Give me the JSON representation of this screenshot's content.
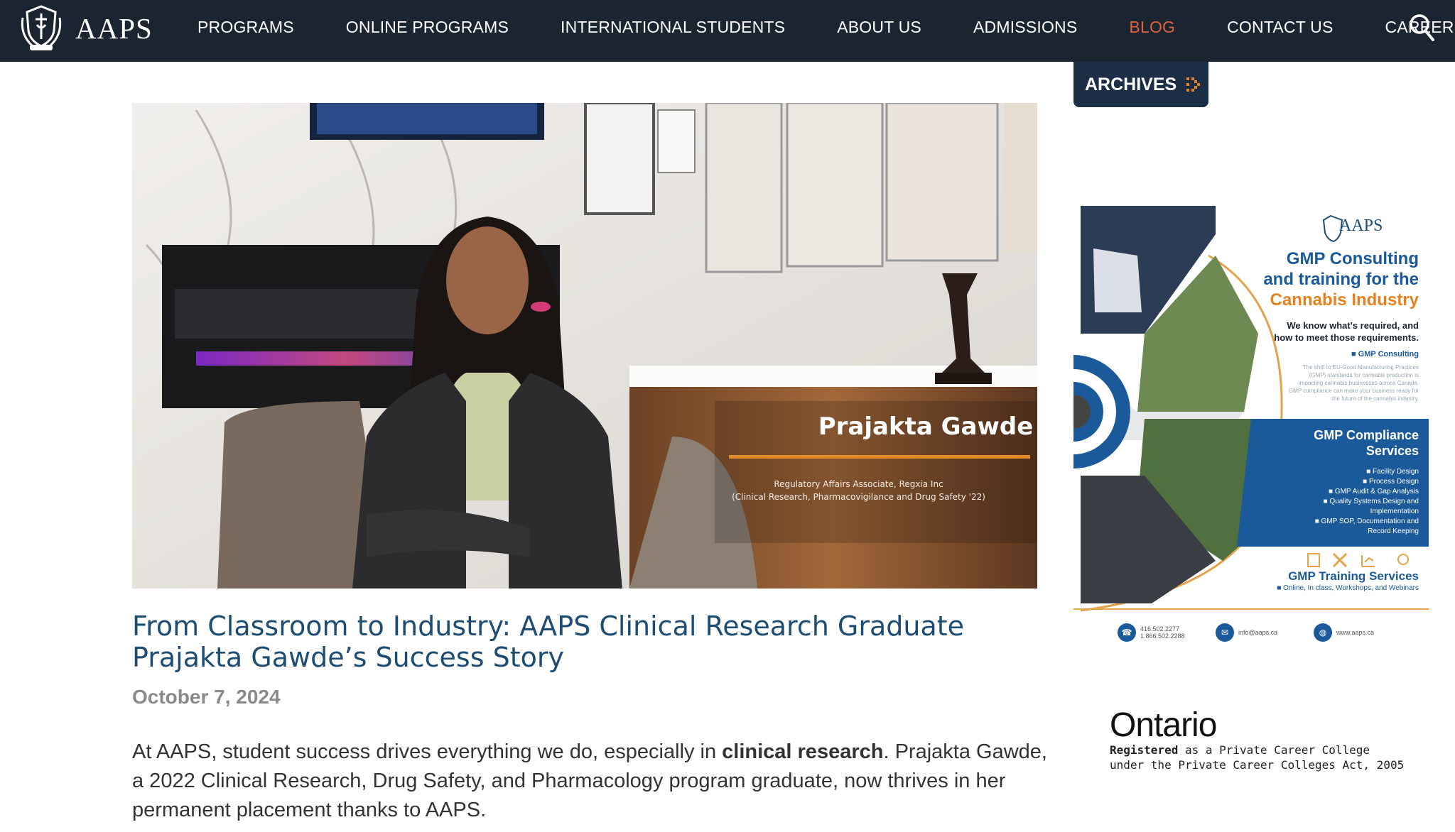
{
  "nav": {
    "logo_text": "AAPS",
    "items": [
      {
        "label": "PROGRAMS",
        "active": false
      },
      {
        "label": "ONLINE PROGRAMS",
        "active": false
      },
      {
        "label": "INTERNATIONAL STUDENTS",
        "active": false
      },
      {
        "label": "ABOUT US",
        "active": false
      },
      {
        "label": "ADMISSIONS",
        "active": false
      },
      {
        "label": "BLOG",
        "active": true
      },
      {
        "label": "CONTACT US",
        "active": false
      },
      {
        "label": "CAREER",
        "active": false
      }
    ],
    "search_icon": "search-icon",
    "active_color": "#e0623b",
    "bg_color": "#1b2431"
  },
  "hero": {
    "name": "Prajakta Gawde",
    "role_line1": "Regulatory Affairs Associate, Regxia Inc",
    "role_line2": "(Clinical Research, Pharmacovigilance and Drug Safety '22)"
  },
  "article": {
    "title": "From Classroom to Industry: AAPS Clinical Research Graduate Prajakta Gawde’s Success Story",
    "date": "October 7, 2024",
    "body_pre": "At AAPS, student success drives everything we do, especially in ",
    "body_bold": "clinical research",
    "body_post": ". Prajakta Gawde, a 2022 Clinical Research, Drug Safety, and Pharmacology program graduate, now thrives in her permanent placement thanks to AAPS.",
    "title_color": "#1e4d73"
  },
  "sidebar": {
    "archives_label": "ARCHIVES",
    "archives_icon": "double-chevron-right-icon",
    "ad": {
      "brand": "AAPS",
      "head_line1": "GMP Consulting",
      "head_line2": "and training for the",
      "head_line3": "Cannabis Industry",
      "sub_line1": "We know what's required, and",
      "sub_line2": "how to meet those requirements.",
      "consulting_title": "■ GMP Consulting",
      "consulting_text": "The shift to EU-Good Manufacturing Practices (GMP) standards for cannabis production is impacting cannabis businesses across Canada. GMP compliance can make your business ready for the future of the cannabis industry.",
      "compliance_line1": "GMP Compliance",
      "compliance_line2": "Services",
      "compliance_items": [
        "■ Facility Design",
        "■ Process Design",
        "■ GMP Audit & Gap Analysis",
        "■ Quality Systems Design and",
        "Implementation",
        "■ GMP SOP, Documentation and",
        "Record Keeping"
      ],
      "training_title": "GMP Training Services",
      "training_sub": "■ Online, In class, Workshops, and Webinars",
      "phone": "416.502.2277",
      "phone2": "1.866.502.2288",
      "email": "info@aaps.ca",
      "web": "www.aaps.ca"
    },
    "ontario": {
      "word": "Ontario",
      "line1_bold": "Registered",
      "line1_rest": " as a Private Career College",
      "line2": "under the Private Career Colleges Act, 2005"
    }
  }
}
